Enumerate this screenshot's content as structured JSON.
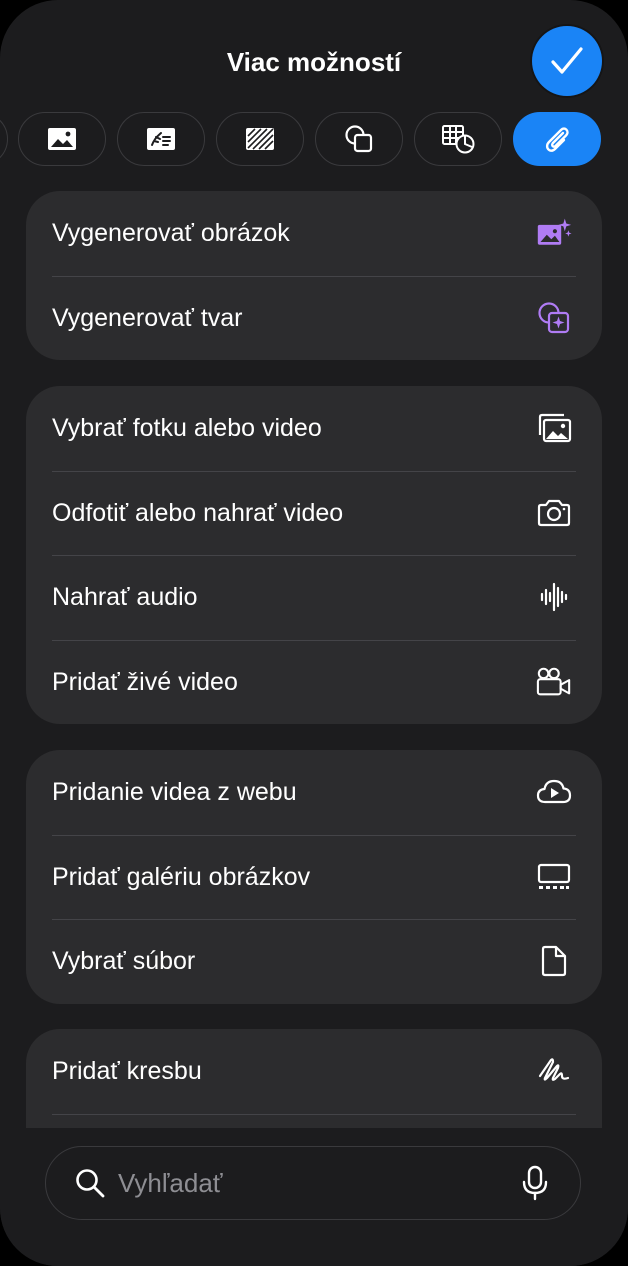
{
  "header": {
    "title": "Viac možností",
    "done_icon": "checkmark-icon"
  },
  "toolbar": {
    "tools": [
      {
        "icon": "image-icon",
        "active": false
      },
      {
        "icon": "media-icon",
        "active": false
      },
      {
        "icon": "pattern-icon",
        "active": false
      },
      {
        "icon": "shapes-icon",
        "active": false
      },
      {
        "icon": "table-chart-icon",
        "active": false
      },
      {
        "icon": "paperclip-icon",
        "active": true
      }
    ]
  },
  "groups": [
    {
      "items": [
        {
          "label": "Vygenerovať obrázok",
          "icon": "sparkle-image-icon"
        },
        {
          "label": "Vygenerovať tvar",
          "icon": "sparkle-shape-icon"
        }
      ]
    },
    {
      "items": [
        {
          "label": "Vybrať fotku alebo video",
          "icon": "photos-icon"
        },
        {
          "label": "Odfotiť alebo nahrať video",
          "icon": "camera-icon"
        },
        {
          "label": "Nahrať audio",
          "icon": "waveform-icon"
        },
        {
          "label": "Pridať živé video",
          "icon": "video-camera-icon"
        }
      ]
    },
    {
      "items": [
        {
          "label": "Pridanie videa z webu",
          "icon": "cloud-play-icon"
        },
        {
          "label": "Pridať galériu obrázkov",
          "icon": "gallery-icon"
        },
        {
          "label": "Vybrať súbor",
          "icon": "document-icon"
        }
      ]
    },
    {
      "items": [
        {
          "label": "Pridať kresbu",
          "icon": "scribble-icon"
        }
      ]
    }
  ],
  "search": {
    "placeholder": "Vyhľadať",
    "search_icon": "magnifier-icon",
    "mic_icon": "microphone-icon"
  },
  "colors": {
    "accent": "#1a84f6",
    "ai_purple": "#b07cf4",
    "sheet": "#1c1c1e",
    "card": "#2c2c2e"
  }
}
